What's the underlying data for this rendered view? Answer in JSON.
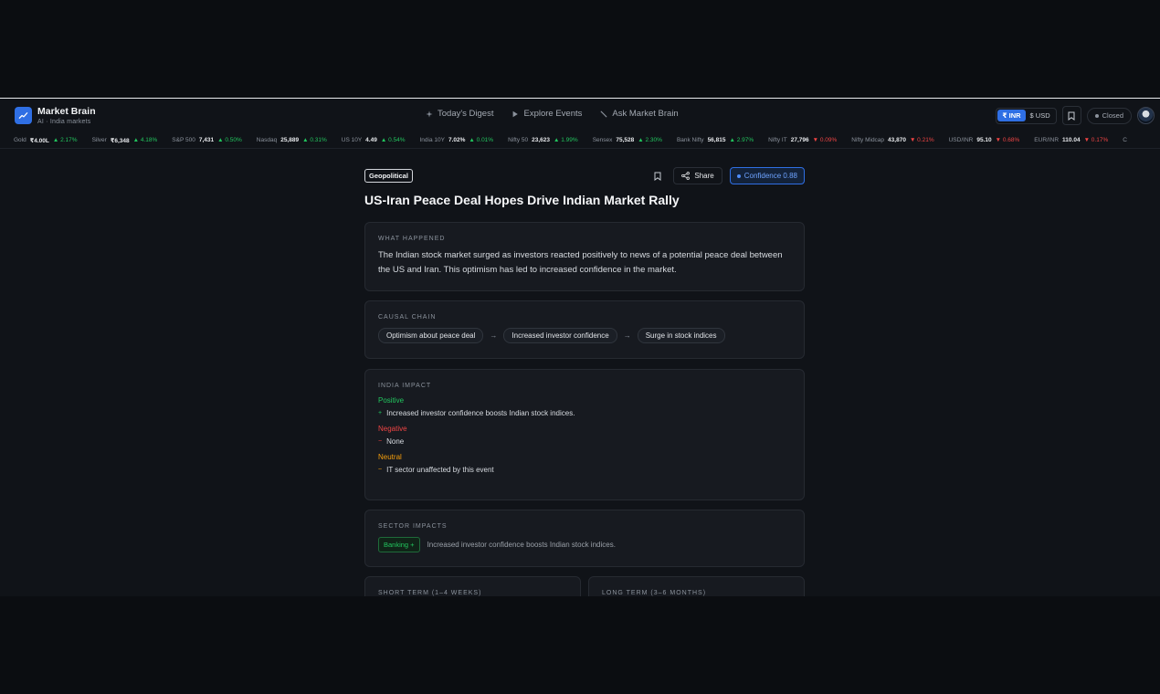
{
  "header": {
    "brand_name": "Market Brain",
    "brand_sub": "AI · India markets",
    "nav": [
      {
        "label": "Today's Digest",
        "icon": "sparkle-icon"
      },
      {
        "label": "Explore Events",
        "icon": "play-icon"
      },
      {
        "label": "Ask Market Brain",
        "icon": "pen-icon"
      }
    ],
    "currency_inr": "₹ INR",
    "currency_usd": "$ USD",
    "market_status": "Closed"
  },
  "ticker": [
    {
      "name": "Gold",
      "value": "₹4.00L",
      "change": "▲ 2.17%",
      "dir": "up"
    },
    {
      "name": "Silver",
      "value": "₹6,348",
      "change": "▲ 4.18%",
      "dir": "up"
    },
    {
      "name": "S&P 500",
      "value": "7,431",
      "change": "▲ 0.50%",
      "dir": "up"
    },
    {
      "name": "Nasdaq",
      "value": "25,889",
      "change": "▲ 0.31%",
      "dir": "up"
    },
    {
      "name": "US 10Y",
      "value": "4.49",
      "change": "▲ 0.54%",
      "dir": "up"
    },
    {
      "name": "India 10Y",
      "value": "7.02%",
      "change": "▲ 0.01%",
      "dir": "up"
    },
    {
      "name": "Nifty 50",
      "value": "23,623",
      "change": "▲ 1.99%",
      "dir": "up"
    },
    {
      "name": "Sensex",
      "value": "75,528",
      "change": "▲ 2.30%",
      "dir": "up"
    },
    {
      "name": "Bank Nifty",
      "value": "56,815",
      "change": "▲ 2.97%",
      "dir": "up"
    },
    {
      "name": "Nifty IT",
      "value": "27,796",
      "change": "▼ 0.09%",
      "dir": "down"
    },
    {
      "name": "Nifty Midcap",
      "value": "43,870",
      "change": "▼ 0.21%",
      "dir": "down"
    },
    {
      "name": "USD/INR",
      "value": "95.10",
      "change": "▼ 0.68%",
      "dir": "down"
    },
    {
      "name": "EUR/INR",
      "value": "110.04",
      "change": "▼ 0.17%",
      "dir": "down"
    },
    {
      "name": "C",
      "value": "",
      "change": "",
      "dir": "up"
    }
  ],
  "article": {
    "tag": "Geopolitical",
    "share_label": "Share",
    "confidence_label": "Confidence 0.88",
    "title": "US-Iran Peace Deal Hopes Drive Indian Market Rally"
  },
  "what_happened": {
    "label": "WHAT HAPPENED",
    "text": "The Indian stock market surged as investors reacted positively to news of a potential peace deal between the US and Iran. This optimism has led to increased confidence in the market."
  },
  "causal_chain": {
    "label": "CAUSAL CHAIN",
    "steps": [
      "Optimism about peace deal",
      "Increased investor confidence",
      "Surge in stock indices"
    ],
    "arrow": "→"
  },
  "india_impact": {
    "label": "INDIA IMPACT",
    "positive": {
      "heading": "Positive",
      "bullet": "+",
      "item": "Increased investor confidence boosts Indian stock indices."
    },
    "negative": {
      "heading": "Negative",
      "bullet": "−",
      "item": "None"
    },
    "neutral": {
      "heading": "Neutral",
      "bullet": "~",
      "item": "IT sector unaffected by this event"
    }
  },
  "sector_impacts": {
    "label": "SECTOR IMPACTS",
    "badge": "Banking +",
    "text": "Increased investor confidence boosts Indian stock indices."
  },
  "short_term": {
    "label": "SHORT TERM (1–4 WEEKS)"
  },
  "long_term": {
    "label": "LONG TERM (3–6 MONTHS)"
  }
}
